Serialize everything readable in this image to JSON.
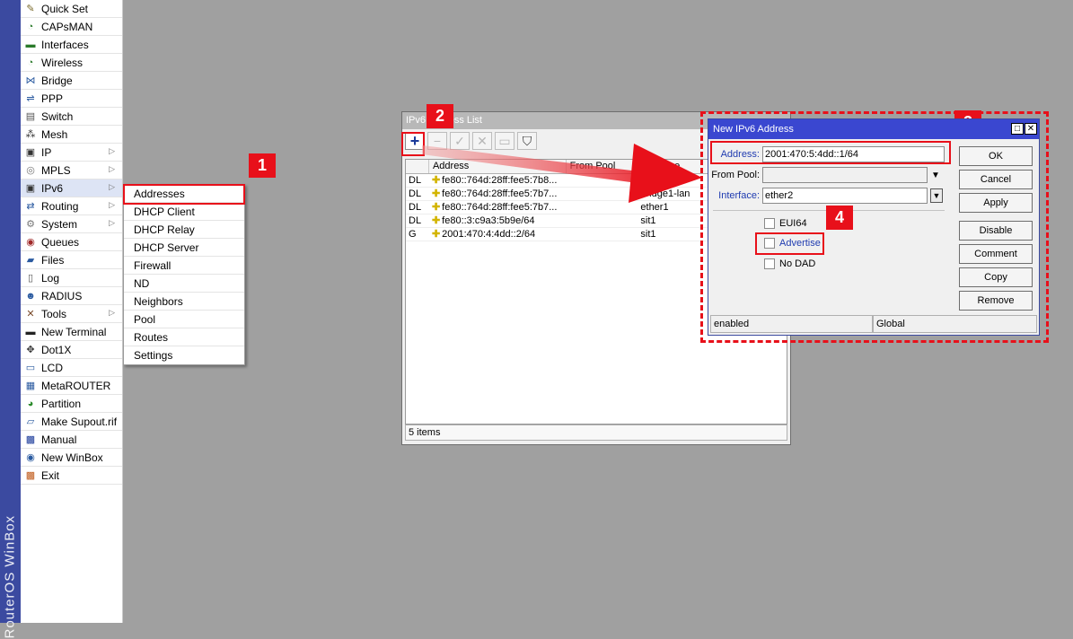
{
  "brand": {
    "text": "RouterOS WinBox"
  },
  "menu": {
    "items": [
      {
        "label": "Quick Set",
        "icon": "wand-icon",
        "glyph": "✎",
        "color": "#7a6a2a",
        "submenu": false
      },
      {
        "label": "CAPsMAN",
        "icon": "wifi-icon",
        "glyph": "◔",
        "color": "#2a7a2a",
        "submenu": false
      },
      {
        "label": "Interfaces",
        "icon": "interface-icon",
        "glyph": "▬",
        "color": "#2a7a2a",
        "submenu": false
      },
      {
        "label": "Wireless",
        "icon": "wireless-icon",
        "glyph": "◔",
        "color": "#2a7a2a",
        "submenu": false
      },
      {
        "label": "Bridge",
        "icon": "bridge-icon",
        "glyph": "⋈",
        "color": "#2a5aa0",
        "submenu": false
      },
      {
        "label": "PPP",
        "icon": "ppp-icon",
        "glyph": "⇌",
        "color": "#2a5aa0",
        "submenu": false
      },
      {
        "label": "Switch",
        "icon": "switch-icon",
        "glyph": "▤",
        "color": "#555555",
        "submenu": false
      },
      {
        "label": "Mesh",
        "icon": "mesh-icon",
        "glyph": "⁂",
        "color": "#333333",
        "submenu": false
      },
      {
        "label": "IP",
        "icon": "ip-icon",
        "glyph": "▣",
        "color": "#333333",
        "submenu": true
      },
      {
        "label": "MPLS",
        "icon": "mpls-icon",
        "glyph": "◎",
        "color": "#777777",
        "submenu": true
      },
      {
        "label": "IPv6",
        "icon": "ipv6-icon",
        "glyph": "▣",
        "color": "#333333",
        "submenu": true
      },
      {
        "label": "Routing",
        "icon": "routing-icon",
        "glyph": "⇄",
        "color": "#2a5aa0",
        "submenu": true
      },
      {
        "label": "System",
        "icon": "gear-icon",
        "glyph": "⚙",
        "color": "#777777",
        "submenu": true
      },
      {
        "label": "Queues",
        "icon": "queues-icon",
        "glyph": "◉",
        "color": "#a02a2a",
        "submenu": false
      },
      {
        "label": "Files",
        "icon": "folder-icon",
        "glyph": "▰",
        "color": "#2a5aa0",
        "submenu": false
      },
      {
        "label": "Log",
        "icon": "log-icon",
        "glyph": "▯",
        "color": "#555555",
        "submenu": false
      },
      {
        "label": "RADIUS",
        "icon": "radius-icon",
        "glyph": "☻",
        "color": "#2a5aa0",
        "submenu": false
      },
      {
        "label": "Tools",
        "icon": "tools-icon",
        "glyph": "✕",
        "color": "#7a4a2a",
        "submenu": true
      },
      {
        "label": "New Terminal",
        "icon": "terminal-icon",
        "glyph": "▬",
        "color": "#222222",
        "submenu": false
      },
      {
        "label": "Dot1X",
        "icon": "dot1x-icon",
        "glyph": "✥",
        "color": "#333333",
        "submenu": false
      },
      {
        "label": "LCD",
        "icon": "lcd-icon",
        "glyph": "▭",
        "color": "#2a5aa0",
        "submenu": false
      },
      {
        "label": "MetaROUTER",
        "icon": "metarouter-icon",
        "glyph": "▦",
        "color": "#2a5aa0",
        "submenu": false
      },
      {
        "label": "Partition",
        "icon": "partition-icon",
        "glyph": "◕",
        "color": "#2a8a2a",
        "submenu": false
      },
      {
        "label": "Make Supout.rif",
        "icon": "supout-icon",
        "glyph": "▱",
        "color": "#2a5aa0",
        "submenu": false
      },
      {
        "label": "Manual",
        "icon": "manual-icon",
        "glyph": "▩",
        "color": "#1a3a9a",
        "submenu": false
      },
      {
        "label": "New WinBox",
        "icon": "winbox-icon",
        "glyph": "◉",
        "color": "#2a5aa0",
        "submenu": false
      },
      {
        "label": "Exit",
        "icon": "exit-icon",
        "glyph": "▩",
        "color": "#c05a1a",
        "submenu": false
      }
    ]
  },
  "submenu": {
    "items": [
      "Addresses",
      "DHCP Client",
      "DHCP Relay",
      "DHCP Server",
      "Firewall",
      "ND",
      "Neighbors",
      "Pool",
      "Routes",
      "Settings"
    ]
  },
  "badges": {
    "b1": "1",
    "b2": "2",
    "b3": "3",
    "b4": "4"
  },
  "address_list": {
    "title": "IPv6 Address List",
    "columns": [
      "",
      "Address",
      "From Pool",
      "Interface"
    ],
    "rows": [
      {
        "flag": "DL",
        "address": "fe80::764d:28ff:fee5:7b8...",
        "pool": "",
        "iface": "ether6"
      },
      {
        "flag": "DL",
        "address": "fe80::764d:28ff:fee5:7b7...",
        "pool": "",
        "iface": "bridge1-lan"
      },
      {
        "flag": "DL",
        "address": "fe80::764d:28ff:fee5:7b7...",
        "pool": "",
        "iface": "ether1"
      },
      {
        "flag": "DL",
        "address": "fe80::3:c9a3:5b9e/64",
        "pool": "",
        "iface": "sit1"
      },
      {
        "flag": "G",
        "address": "2001:470:4:4dd::2/64",
        "pool": "",
        "iface": "sit1"
      }
    ],
    "status": "5 items"
  },
  "dialog": {
    "title": "New IPv6 Address",
    "address_label": "Address:",
    "address_value": "2001:470:5:4dd::1/64",
    "from_pool_label": "From Pool:",
    "from_pool_value": "",
    "interface_label": "Interface:",
    "interface_value": "ether2",
    "eui64_label": "EUI64",
    "advertise_label": "Advertise",
    "nodad_label": "No DAD",
    "buttons": [
      "OK",
      "Cancel",
      "Apply",
      "Disable",
      "Comment",
      "Copy",
      "Remove"
    ],
    "status_left": "enabled",
    "status_right": "Global"
  }
}
